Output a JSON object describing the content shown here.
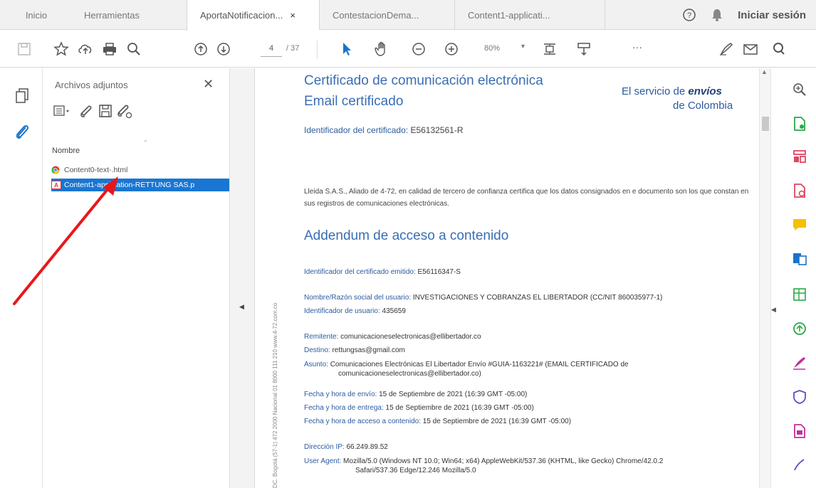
{
  "tabs": {
    "home": "Inicio",
    "tools": "Herramientas",
    "doc1": "AportaNotificacion...",
    "doc2": "ContestacionDema...",
    "doc3": "Content1-applicati...",
    "close_glyph": "×"
  },
  "header": {
    "signin": "Iniciar sesión"
  },
  "toolbar": {
    "page_current": "4",
    "page_total": "/ 37",
    "zoom": "80%",
    "more": "···",
    "dropdown_glyph": "▾"
  },
  "attachments": {
    "title": "Archivos adjuntos",
    "close": "✕",
    "column": "Nombre",
    "items": [
      {
        "name": "Content0-text-.html",
        "icon": "chrome-icon"
      },
      {
        "name": "Content1-application-RETTUNG SAS.p",
        "icon": "pdf-icon",
        "selected": true
      }
    ]
  },
  "document": {
    "vertical_text": "DC. Bogotá (57-1) 472 2000 Nacional 01 8000 111 210 www.4-72.com.co",
    "title": "Certificado de comunicación electrónica",
    "subtitle": "Email certificado",
    "brand_line1_pre": "El servicio de ",
    "brand_line1_bold": "envíos",
    "brand_line2": "de Colombia",
    "cert_id_label": "Identificador del certificado:",
    "cert_id_value": "E56132561-R",
    "paragraph": "Lleida S.A.S., Aliado de 4-72, en calidad de tercero de confianza certifica que los datos consignados en e documento son los que constan en sus registros de comunicaciones electrónicas.",
    "addendum_title": "Addendum de acceso a contenido",
    "fields": {
      "cert_emitted_label": "Identificador del certificado emitido:",
      "cert_emitted_value": "E56116347-S",
      "user_name_label": "Nombre/Razón social del usuario:",
      "user_name_value": "INVESTIGACIONES Y COBRANZAS EL LIBERTADOR (CC/NIT 860035977-1)",
      "user_id_label": "Identificador de usuario:",
      "user_id_value": "435659",
      "sender_label": "Remitente:",
      "sender_value": "comunicacioneselectronicas@ellibertador.co",
      "dest_label": "Destino:",
      "dest_value": "rettungsas@gmail.com",
      "subject_label": "Asunto:",
      "subject_value_1": "Comunicaciones Electrónicas El Libertador Envío #GUIA-1163221# (EMAIL CERTIFICADO de",
      "subject_value_2": "comunicacioneselectronicas@ellibertador.co)",
      "sent_label": "Fecha y hora de envío:",
      "sent_value": "15 de Septiembre de 2021 (16:39 GMT -05:00)",
      "delivered_label": "Fecha y hora de entrega:",
      "delivered_value": "15 de Septiembre de 2021 (16:39 GMT -05:00)",
      "accessed_label": "Fecha y hora de acceso a contenido:",
      "accessed_value": "15 de Septiembre de 2021 (16:39 GMT -05:00)",
      "ip_label": "Dirección IP:",
      "ip_value": "66.249.89.52",
      "ua_label": "User Agent:",
      "ua_value_1": "Mozilla/5.0 (Windows NT 10.0; Win64; x64) AppleWebKit/537.36 (KHTML, like Gecko) Chrome/42.0.2",
      "ua_value_2": "Safari/537.36 Edge/12.246 Mozilla/5.0"
    }
  },
  "colors": {
    "accent": "#1976d2",
    "doc_blue": "#2b5b9e",
    "arrow": "#e8171a",
    "icon_blue": "#1a73c9"
  }
}
